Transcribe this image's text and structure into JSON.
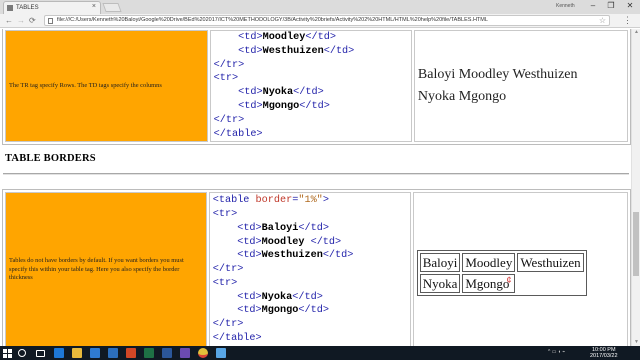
{
  "browser": {
    "tab_title": "TABLES",
    "tab_close": "×",
    "user_name": "Kenneth",
    "window_controls": {
      "minimize": "–",
      "maximize": "❐",
      "close": "✕"
    },
    "nav": {
      "back": "←",
      "forward": "→",
      "reload": "⟳"
    },
    "url": "file:///C:/Users/Kenneth%20Baloyi/Google%20Drive/BEd%202017/ICT%20METHODOLOGY/3B/Activity%20briefs/Activity%202%20HTML/HTML%20help%20file/TABLES.HTML",
    "star": "☆",
    "menu": "⋮"
  },
  "section1": {
    "description": "The TR tag specify Rows. The TD tags specify the columns",
    "code": {
      "l1_open": "<td>",
      "l1_text": "Moodley",
      "l1_close": "</td>",
      "l2_open": "<td>",
      "l2_text": "Westhuizen",
      "l2_close": "</td>",
      "l3": "</tr>",
      "l4": "<tr>",
      "l5_open": "<td>",
      "l5_text": "Nyoka",
      "l5_close": "</td>",
      "l6_open": "<td>",
      "l6_text": "Mgongo",
      "l6_close": "</td>",
      "l7": "</tr>",
      "l8": "</table>"
    },
    "rendered": {
      "row1": "Baloyi Moodley Westhuizen",
      "row2": "Nyoka Mgongo"
    }
  },
  "section2": {
    "heading": "TABLE BORDERS",
    "description": "Tables do not have borders by default. If you want borders you must specify this within your table tag. Here you also specify the border thickness",
    "code": {
      "l1_tag": "<table ",
      "l1_attr": "border",
      "l1_eq": "=",
      "l1_val": "\"1%\"",
      "l1_end": ">",
      "l2": "<tr>",
      "l3_open": "<td>",
      "l3_text": "Baloyi",
      "l3_close": "</td>",
      "l4_open": "<td>",
      "l4_text": "Moodley",
      "l4_close": " </td>",
      "l5_open": "<td>",
      "l5_text": "Westhuizen",
      "l5_close": "</td>",
      "l6": "</tr>",
      "l7": "<tr>",
      "l8_open": "<td>",
      "l8_text": "Nyoka",
      "l8_close": "</td>",
      "l9_open": "<td>",
      "l9_text": "Mgongo",
      "l9_close": "</td>",
      "l10": "</tr>",
      "l11": "</table>"
    },
    "rendered": {
      "row1": [
        "Baloyi",
        "Moodley",
        "Westhuizen"
      ],
      "row2": [
        "Nyoka",
        "Mgongo"
      ]
    }
  },
  "scrollbar": {
    "up": "▲",
    "down": "▼"
  },
  "taskbar": {
    "icons": [
      "start-icon",
      "search-icon",
      "task-view-icon",
      "edge-icon",
      "file-explorer-icon",
      "store-icon",
      "mail-icon",
      "powerpoint-icon",
      "excel-icon",
      "word-icon",
      "app-icon",
      "chrome-icon",
      "paint-icon"
    ],
    "time": "10:00 PM",
    "date": "2017/03/22"
  }
}
